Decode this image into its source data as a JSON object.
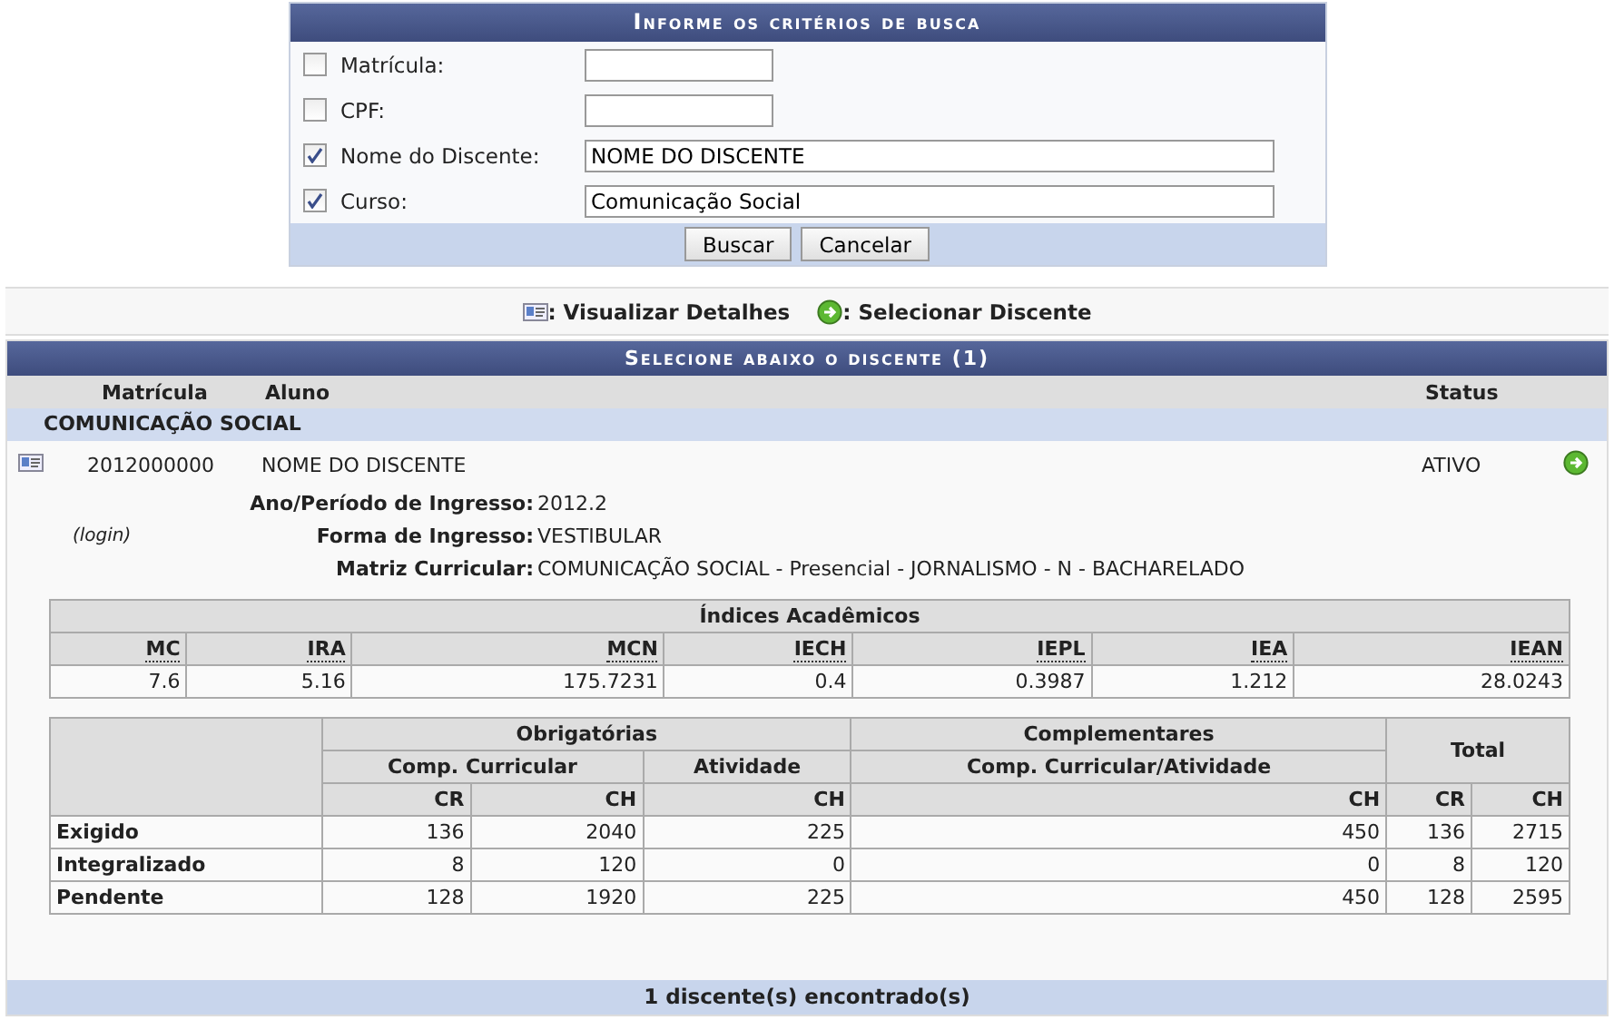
{
  "search_form": {
    "title": "Informe os critérios de busca",
    "fields": [
      {
        "label": "Matrícula:",
        "checked": false,
        "kind": "short"
      },
      {
        "label": "CPF:",
        "checked": false,
        "kind": "short"
      },
      {
        "label": "Nome do Discente:",
        "checked": true,
        "kind": "long",
        "value": "NOME DO DISCENTE"
      },
      {
        "label": "Curso:",
        "checked": true,
        "kind": "long",
        "value": "Comunicação Social"
      }
    ],
    "buttons": [
      "Buscar",
      "Cancelar"
    ]
  },
  "legend": [
    {
      "kind": "details",
      "label": ": Visualizar Detalhes"
    },
    {
      "kind": "select",
      "label": ": Selecionar Discente"
    }
  ],
  "results": {
    "title": "Selecione abaixo o discente (1)",
    "columns": [
      "Matrícula",
      "Aluno",
      "Status"
    ],
    "group": "COMUNICAÇÃO SOCIAL",
    "rows": [
      {
        "matricula": "2012000000",
        "aluno": "NOME DO DISCENTE",
        "status": "ATIVO"
      }
    ],
    "login": "(login)",
    "details": [
      {
        "label": "Ano/Período de Ingresso:",
        "value": "2012.2"
      },
      {
        "label": "Forma de Ingresso:",
        "value": "VESTIBULAR"
      },
      {
        "label": "Matriz Curricular:",
        "value": "COMUNICAÇÃO SOCIAL - Presencial - JORNALISMO - N - BACHARELADO"
      }
    ],
    "indices": {
      "title": "Índices Acadêmicos",
      "columns": [
        "MC",
        "IRA",
        "MCN",
        "IECH",
        "IEPL",
        "IEA",
        "IEAN"
      ],
      "values": [
        "7.6",
        "5.16",
        "175.7231",
        "0.4",
        "0.3987",
        "1.212",
        "28.0243"
      ]
    },
    "workload": {
      "groups": [
        "Obrigatórias",
        "Complementares",
        "Total"
      ],
      "subgroups": [
        "Comp. Curricular",
        "Atividade",
        "Comp. Curricular/Atividade"
      ],
      "units": [
        "CR",
        "CH",
        "CH",
        "CH",
        "CR",
        "CH"
      ],
      "rows": [
        {
          "label": "Exigido",
          "cells": [
            "136",
            "2040",
            "225",
            "450",
            "136",
            "2715"
          ]
        },
        {
          "label": "Integralizado",
          "cells": [
            "8",
            "120",
            "0",
            "0",
            "8",
            "120"
          ]
        },
        {
          "label": "Pendente",
          "cells": [
            "128",
            "1920",
            "225",
            "450",
            "128",
            "2595"
          ]
        }
      ]
    },
    "footer": "1 discente(s) encontrado(s)"
  }
}
